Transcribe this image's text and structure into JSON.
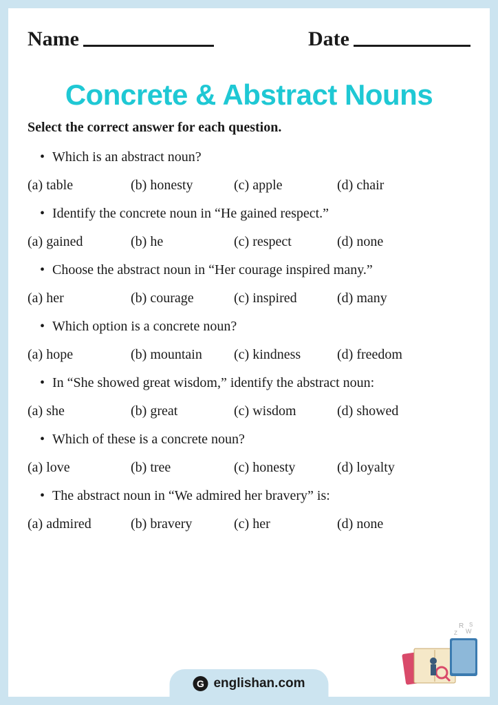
{
  "header": {
    "name_label": "Name",
    "date_label": "Date"
  },
  "title": "Concrete & Abstract Nouns",
  "instructions": "Select the correct answer for each question.",
  "questions": [
    {
      "text": "Which is an abstract noun?",
      "options": [
        "(a) table",
        "(b) honesty",
        "(c) apple",
        "(d) chair"
      ]
    },
    {
      "text": "Identify the concrete noun in “He gained respect.”",
      "options": [
        "(a) gained",
        "(b) he",
        "(c) respect",
        "(d) none"
      ]
    },
    {
      "text": "Choose the abstract noun in “Her courage inspired many.”",
      "options": [
        "(a) her",
        "(b) courage",
        "(c) inspired",
        "(d) many"
      ]
    },
    {
      "text": "Which option is a concrete noun?",
      "options": [
        "(a) hope",
        "(b) mountain",
        "(c) kindness",
        "(d) freedom"
      ]
    },
    {
      "text": "In “She showed great wisdom,” identify the abstract noun:",
      "options": [
        "(a) she",
        "(b) great",
        "(c) wisdom",
        "(d) showed"
      ]
    },
    {
      "text": "Which of these is a concrete noun?",
      "options": [
        "(a) love",
        "(b) tree",
        "(c) honesty",
        "(d) loyalty"
      ]
    },
    {
      "text": "The abstract noun in “We admired her bravery” is:",
      "options": [
        "(a) admired",
        "(b) bravery",
        "(c) her",
        "(d) none"
      ]
    }
  ],
  "footer": {
    "brand": "englishan.com"
  }
}
